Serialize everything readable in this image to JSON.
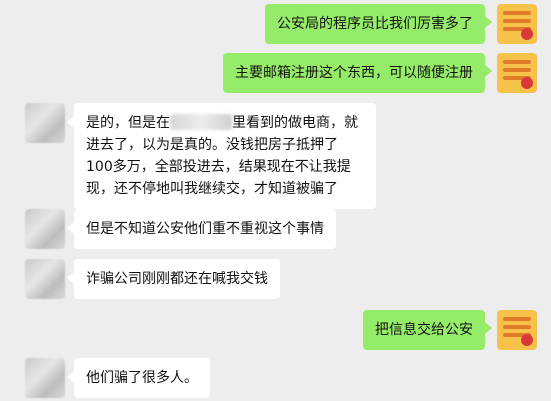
{
  "messages": [
    {
      "side": "me",
      "text": "公安局的程序员比我们厉害多了"
    },
    {
      "side": "me",
      "text": "主要邮箱注册这个东西，可以随便注册"
    },
    {
      "side": "other",
      "before_blur": "是的，但是在",
      "after_blur": "里看到的做电商，就进去了，以为是真的。没钱把房子抵押了100多万，全部投进去，结果现在不让我提现，还不停地叫我继续交，才知道被骗了"
    },
    {
      "side": "other",
      "text": "但是不知道公安他们重不重视这个事情"
    },
    {
      "side": "other",
      "text": "诈骗公司刚刚都还在喊我交钱"
    },
    {
      "side": "me",
      "text": "把信息交给公安"
    },
    {
      "side": "other",
      "text": "他们骗了很多人。"
    }
  ],
  "colors": {
    "background": "#ededed",
    "my_bubble": "#95ec69",
    "their_bubble": "#ffffff"
  }
}
